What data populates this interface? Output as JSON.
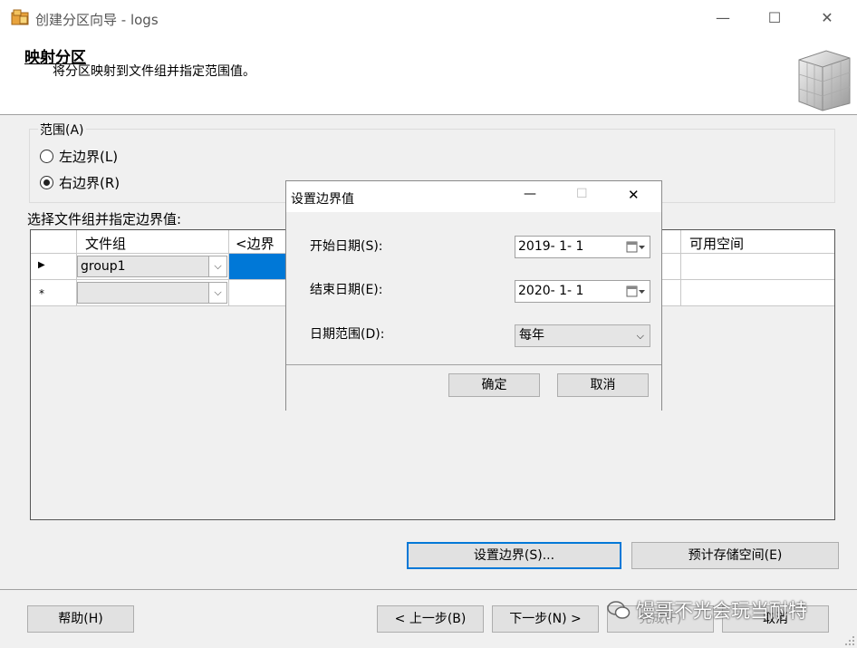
{
  "window": {
    "title": "创建分区向导 - logs",
    "minimize": "—",
    "maximize": "☐",
    "close": "✕"
  },
  "header": {
    "title": "映射分区",
    "subtitle": "将分区映射到文件组并指定范围值。"
  },
  "range": {
    "legend": "范围(A)",
    "left_label": "左边界(L)",
    "right_label": "右边界(R)",
    "selected": "right"
  },
  "grid": {
    "label": "选择文件组并指定边界值:",
    "columns": [
      "文件组",
      "<边界",
      "可用空间"
    ],
    "rows": [
      {
        "indicator": "▶",
        "filegroup": "group1",
        "boundary": "",
        "space": ""
      },
      {
        "indicator": "*",
        "filegroup": "",
        "boundary": "",
        "space": ""
      }
    ]
  },
  "buttons": {
    "set_boundary": "设置边界(S)...",
    "estimate_storage": "预计存储空间(E)",
    "help": "帮助(H)",
    "back": "< 上一步(B)",
    "next": "下一步(N) >",
    "finish": "完成(F)",
    "cancel": "取消"
  },
  "dialog": {
    "title": "设置边界值",
    "minimize": "—",
    "maximize": "☐",
    "close": "✕",
    "start_label": "开始日期(S):",
    "start_value": "2019- 1- 1",
    "end_label": "结束日期(E):",
    "end_value": "2020- 1- 1",
    "range_label": "日期范围(D):",
    "range_value": "每年",
    "ok": "确定",
    "cancel": "取消"
  },
  "watermark": {
    "text": "馒哥不光会玩当耐特"
  },
  "colors": {
    "accent": "#0078d7",
    "window_bg": "#f0f0f0",
    "selected_cell": "#0078d7"
  }
}
